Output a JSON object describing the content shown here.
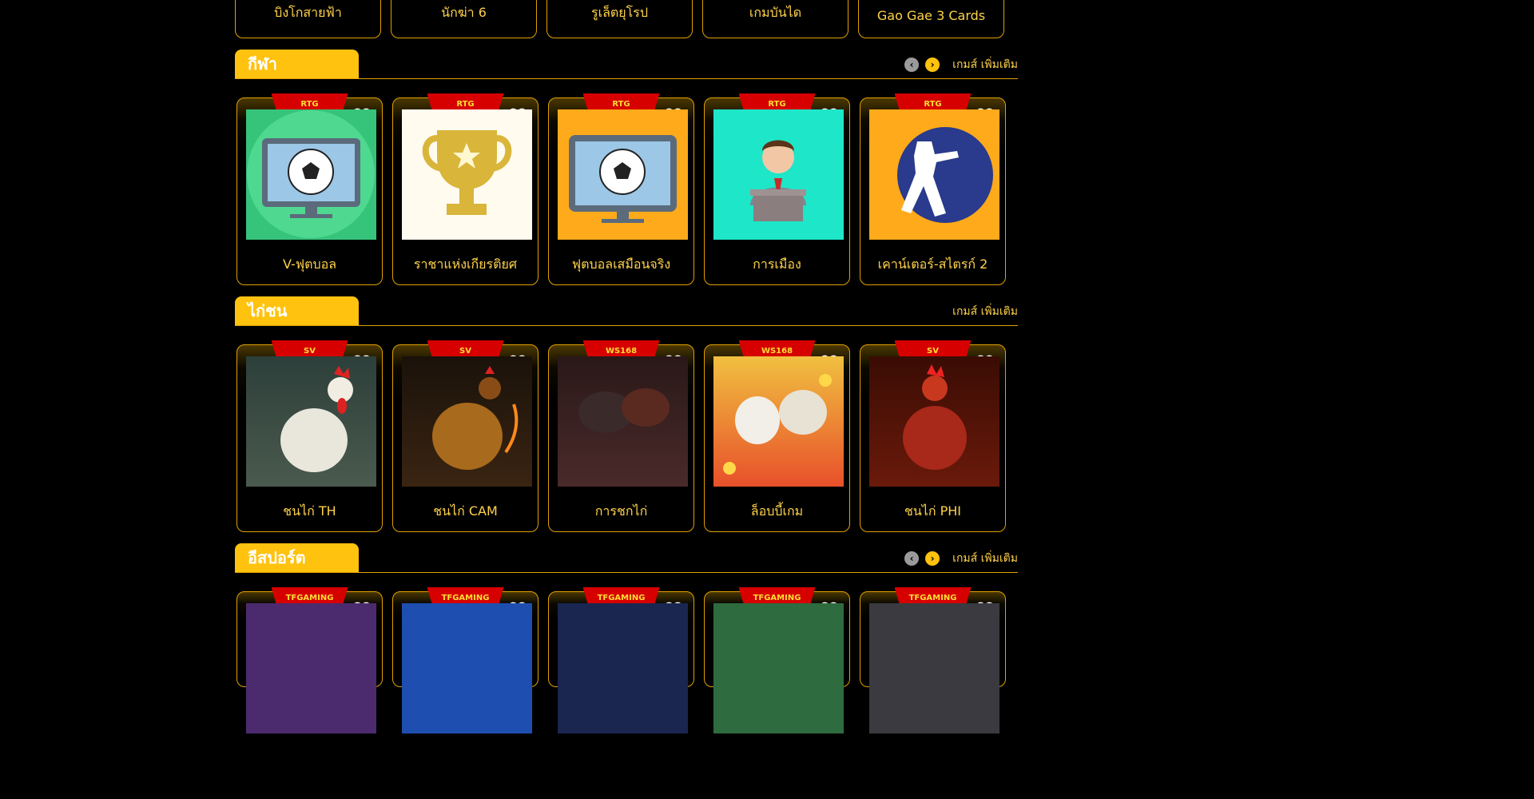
{
  "top_row": [
    "บิงโกสายฟ้า",
    "นักฆ่า 6",
    "รูเล็ตยุโรป",
    "เกมบันได",
    "Gao Gae 3 Cards"
  ],
  "sections": [
    {
      "title": "กีฬา",
      "more": "เกมส์ เพิ่มเติม",
      "has_nav": true,
      "games": [
        {
          "label": "V-ฟุตบอล",
          "provider": "RTG",
          "bg": "#35c47a"
        },
        {
          "label": "ราชาแห่งเกียรติยศ",
          "provider": "RTG",
          "bg": "#fffbee"
        },
        {
          "label": "ฟุตบอลเสมือนจริง",
          "provider": "RTG",
          "bg": "#ffaa1a"
        },
        {
          "label": "การเมือง",
          "provider": "RTG",
          "bg": "#1ee6c8"
        },
        {
          "label": "เคาน์เตอร์-สไตรก์ 2",
          "provider": "RTG",
          "bg": "#ffaa1a"
        }
      ]
    },
    {
      "title": "ไก่ชน",
      "more": "เกมส์ เพิ่มเติม",
      "has_nav": false,
      "games": [
        {
          "label": "ชนไก่ TH",
          "provider": "SV",
          "bg": "#2d3f3a"
        },
        {
          "label": "ชนไก่ CAM",
          "provider": "SV",
          "bg": "#2a1e12"
        },
        {
          "label": "การชกไก่",
          "provider": "WS168",
          "bg": "#3b2020"
        },
        {
          "label": "ล็อบบี้เกม",
          "provider": "WS168",
          "bg": "#f29a2a"
        },
        {
          "label": "ชนไก่ PHI",
          "provider": "SV",
          "bg": "#5a1408"
        }
      ]
    },
    {
      "title": "อีสปอร์ต",
      "more": "เกมส์ เพิ่มเติม",
      "has_nav": true,
      "games": [
        {
          "provider": "TFGAMING",
          "bg": "#4b2b6e"
        },
        {
          "provider": "TFGAMING",
          "bg": "#1e4fb0"
        },
        {
          "provider": "TFGAMING",
          "bg": "#1a2650"
        },
        {
          "provider": "TFGAMING",
          "bg": "#2e6b3f"
        },
        {
          "provider": "TFGAMING",
          "bg": "#3a3a40"
        }
      ]
    }
  ],
  "colors": {
    "accent": "#ffc20e",
    "label": "#ffd24a",
    "ribbon": "#d60000",
    "border": "#e0a100"
  },
  "icons": {
    "favorite": "heart-icon",
    "prev": "chevron-left-icon",
    "next": "chevron-right-icon"
  }
}
